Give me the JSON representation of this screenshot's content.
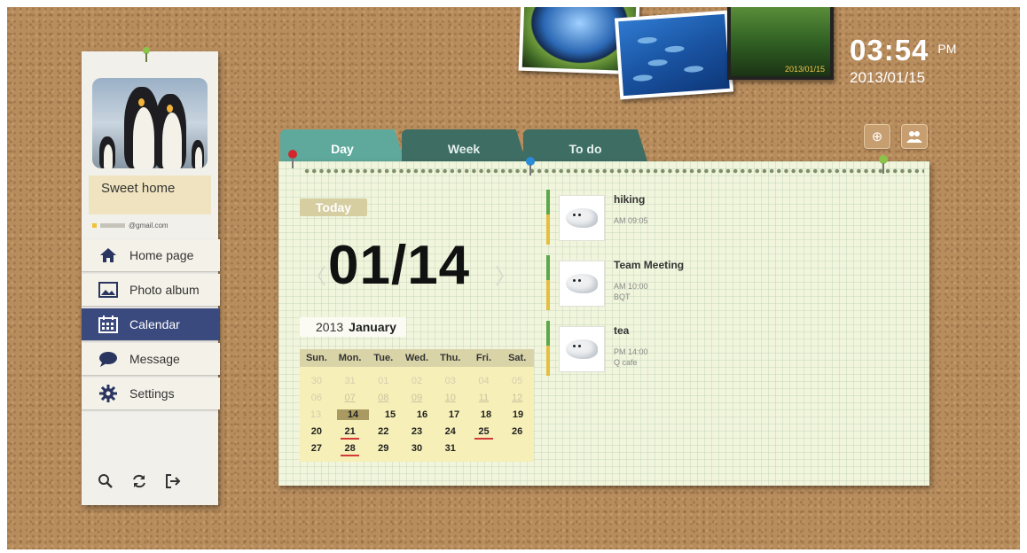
{
  "clock": {
    "time": "03:54",
    "ampm": "PM",
    "date": "2013/01/15"
  },
  "photos": [
    {
      "name": "fisheye-photo"
    },
    {
      "name": "fish-school-photo"
    },
    {
      "name": "forest-photo",
      "stamp": "2013/01/15"
    }
  ],
  "top_buttons": {
    "add_icon": "plus-circle-icon",
    "users_icon": "users-icon"
  },
  "sidebar": {
    "profile_name": "Sweet home",
    "email": "@gmail.com",
    "menu": [
      {
        "label": "Home page",
        "icon": "home-icon"
      },
      {
        "label": "Photo album",
        "icon": "photo-icon"
      },
      {
        "label": "Calendar",
        "icon": "calendar-icon",
        "active": true
      },
      {
        "label": "Message",
        "icon": "message-icon"
      },
      {
        "label": "Settings",
        "icon": "gear-icon"
      }
    ],
    "bottom_icons": [
      "search-icon",
      "refresh-icon",
      "logout-icon"
    ]
  },
  "tabs": [
    {
      "label": "Day",
      "active": true
    },
    {
      "label": "Week"
    },
    {
      "label": "To do"
    }
  ],
  "day_view": {
    "today_label": "Today",
    "big_date": "01/14",
    "year": "2013",
    "month": "January"
  },
  "mini_calendar": {
    "weekdays": [
      "Sun.",
      "Mon.",
      "Tue.",
      "Wed.",
      "Thu.",
      "Fri.",
      "Sat."
    ],
    "rows": [
      [
        "30",
        "31",
        "01",
        "02",
        "03",
        "04",
        "05"
      ],
      [
        "06",
        "07",
        "08",
        "09",
        "10",
        "11",
        "12"
      ],
      [
        "13",
        "14",
        "15",
        "16",
        "17",
        "18",
        "19"
      ],
      [
        "20",
        "21",
        "22",
        "23",
        "24",
        "25",
        "26"
      ],
      [
        "27",
        "28",
        "29",
        "30",
        "31",
        "",
        ""
      ]
    ],
    "selected": "14"
  },
  "events": [
    {
      "title": "hiking",
      "time": "AM 09:05",
      "location": ""
    },
    {
      "title": "Team Meeting",
      "time": "AM 10:00",
      "location": "BQT"
    },
    {
      "title": "tea",
      "time": "PM 14:00",
      "location": "Q cafe"
    }
  ],
  "colors": {
    "accent": "#3b4a7e",
    "tab_active": "#5ea99c",
    "tab": "#3e6d63",
    "cork": "#b88d5e"
  }
}
